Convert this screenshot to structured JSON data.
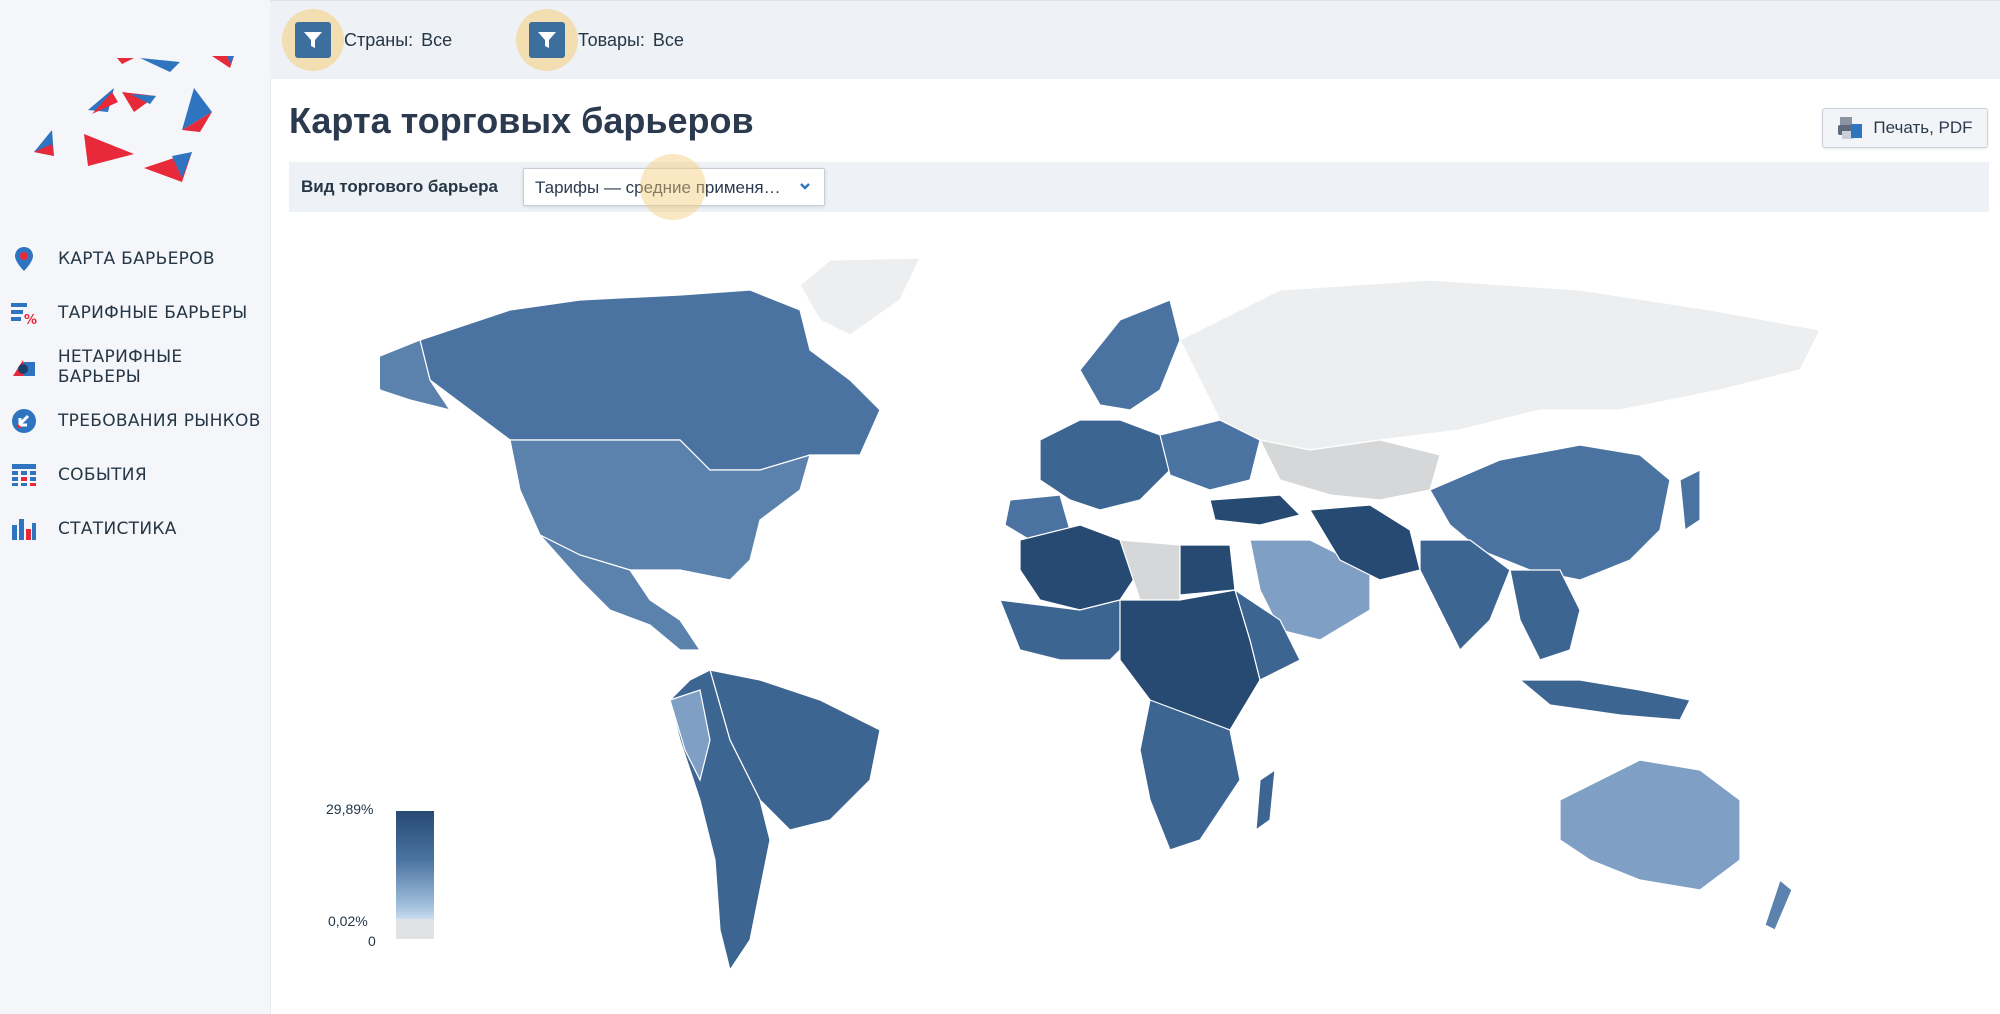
{
  "sidebar": {
    "logo_icon": "triangles-logo",
    "items": [
      {
        "label": "КАРТА БАРЬЕРОВ",
        "icon": "map-pin-icon"
      },
      {
        "label": "ТАРИФНЫЕ БАРЬЕРЫ",
        "icon": "percent-table-icon"
      },
      {
        "label": "НЕТАРИФНЫЕ БАРЬЕРЫ",
        "icon": "shapes-icon"
      },
      {
        "label": "ТРЕБОВАНИЯ РЫНКОВ",
        "icon": "arrow-circle-icon"
      },
      {
        "label": "СОБЫТИЯ",
        "icon": "calendar-grid-icon"
      },
      {
        "label": "СТАТИСТИКА",
        "icon": "bar-chart-icon"
      }
    ]
  },
  "filters": {
    "countries": {
      "label": "Страны:",
      "value": "Все",
      "icon": "filter-icon"
    },
    "goods": {
      "label": "Товары:",
      "value": "Все",
      "icon": "filter-icon"
    }
  },
  "page": {
    "title": "Карта торговых барьеров",
    "print_label": "Печать, PDF",
    "barrier_label": "Вид торгового барьера",
    "barrier_value": "Тарифы — средние применяемые"
  },
  "legend": {
    "max": "29,89%",
    "min": "0,02%",
    "zero": "0"
  },
  "colors": {
    "accent": "#3d6f9e",
    "map_dark": "#264a72",
    "map_mid": "#4b73a1",
    "map_light": "#7fa0c4",
    "no_data": "#d6d7d9",
    "logo_red": "#e8293a",
    "logo_blue": "#2f74c0"
  }
}
